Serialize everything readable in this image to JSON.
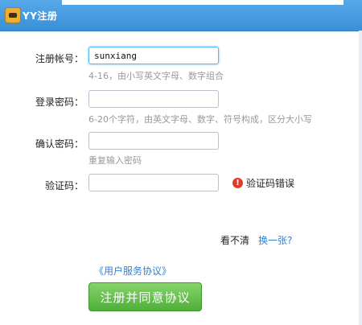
{
  "window": {
    "title": "YY注册"
  },
  "form": {
    "account": {
      "label": "注册帐号：",
      "value": "sunxiang",
      "hint": "4-16，由小写英文字母、数字组合"
    },
    "password": {
      "label": "登录密码：",
      "value": "",
      "hint": "6-20个字符，由英文字母、数字、符号构成，区分大小写"
    },
    "confirm": {
      "label": "确认密码：",
      "value": "",
      "hint": "重复输入密码"
    },
    "captcha": {
      "label": "验证码：",
      "value": "",
      "error": "验证码错误",
      "error_icon": "!"
    },
    "refresh": {
      "label": "看不清",
      "link": "换一张?"
    },
    "terms_link": "《用户服务协议》",
    "submit_label": "注册并同意协议"
  },
  "colors": {
    "accent": "#3a8fd8",
    "link": "#2e82d6",
    "submit": "#4fae3a",
    "error": "#e23b2e"
  }
}
